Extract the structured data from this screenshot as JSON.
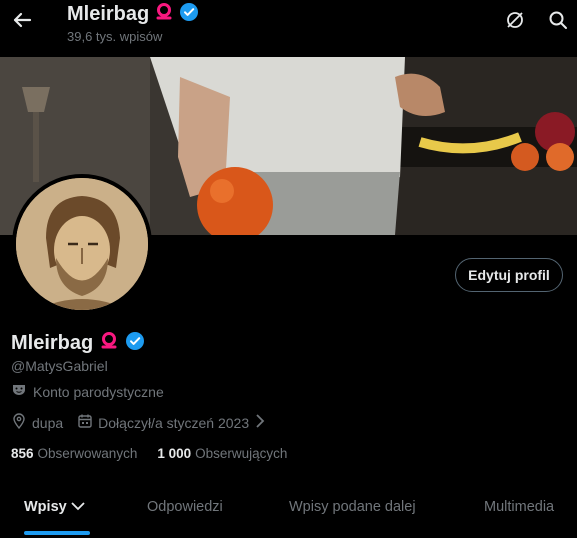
{
  "header": {
    "title": "Mleirbag",
    "post_count": "39,6 tys. wpisów"
  },
  "profile": {
    "name": "Mleirbag",
    "handle": "@MatysGabriel",
    "parody_label": "Konto parodystyczne",
    "location": "dupa",
    "joined": "Dołączył/a styczeń 2023",
    "edit_button": "Edytuj profil"
  },
  "stats": {
    "following_count": "856",
    "following_label": "Obserwowanych",
    "followers_count": "1 000",
    "followers_label": "Obserwujących"
  },
  "tabs": [
    {
      "label": "Wpisy"
    },
    {
      "label": "Odpowiedzi"
    },
    {
      "label": "Wpisy podane dalej"
    },
    {
      "label": "Multimedia"
    }
  ],
  "colors": {
    "accent": "#1d9bf0",
    "verified": "#1d9bf0",
    "badge_pink": "#f91880"
  }
}
